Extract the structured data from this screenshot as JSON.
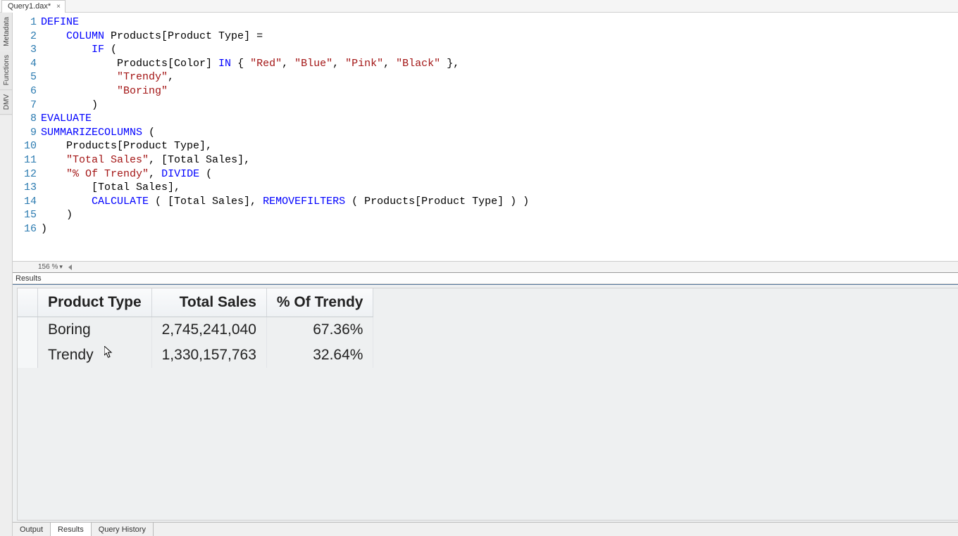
{
  "tab": {
    "title": "Query1.dax*",
    "close": "×"
  },
  "sideTabs": [
    "Metadata",
    "Functions",
    "DMV"
  ],
  "editor": {
    "zoom": "156 %",
    "lines": [
      {
        "n": 1,
        "tokens": [
          [
            "k-blue",
            "DEFINE"
          ]
        ]
      },
      {
        "n": 2,
        "tokens": [
          [
            "",
            "    "
          ],
          [
            "k-blue",
            "COLUMN"
          ],
          [
            "",
            " Products[Product Type] ="
          ]
        ]
      },
      {
        "n": 3,
        "tokens": [
          [
            "",
            "        "
          ],
          [
            "k-blue",
            "IF"
          ],
          [
            "",
            " ("
          ]
        ]
      },
      {
        "n": 4,
        "tokens": [
          [
            "",
            "            Products[Color] "
          ],
          [
            "k-blue",
            "IN"
          ],
          [
            "",
            " { "
          ],
          [
            "k-str",
            "\"Red\""
          ],
          [
            "",
            ", "
          ],
          [
            "k-str",
            "\"Blue\""
          ],
          [
            "",
            ", "
          ],
          [
            "k-str",
            "\"Pink\""
          ],
          [
            "",
            ", "
          ],
          [
            "k-str",
            "\"Black\""
          ],
          [
            "",
            " },"
          ]
        ]
      },
      {
        "n": 5,
        "tokens": [
          [
            "",
            "            "
          ],
          [
            "k-str",
            "\"Trendy\""
          ],
          [
            "",
            ","
          ]
        ]
      },
      {
        "n": 6,
        "tokens": [
          [
            "",
            "            "
          ],
          [
            "k-str",
            "\"Boring\""
          ]
        ]
      },
      {
        "n": 7,
        "tokens": [
          [
            "",
            "        )"
          ]
        ]
      },
      {
        "n": 8,
        "tokens": [
          [
            "k-blue",
            "EVALUATE"
          ]
        ]
      },
      {
        "n": 9,
        "tokens": [
          [
            "k-blue",
            "SUMMARIZECOLUMNS"
          ],
          [
            "",
            " ("
          ]
        ]
      },
      {
        "n": 10,
        "tokens": [
          [
            "",
            "    Products[Product Type],"
          ]
        ]
      },
      {
        "n": 11,
        "tokens": [
          [
            "",
            "    "
          ],
          [
            "k-str",
            "\"Total Sales\""
          ],
          [
            "",
            ", [Total Sales],"
          ]
        ]
      },
      {
        "n": 12,
        "tokens": [
          [
            "",
            "    "
          ],
          [
            "k-str",
            "\"% Of Trendy\""
          ],
          [
            "",
            ", "
          ],
          [
            "k-blue",
            "DIVIDE"
          ],
          [
            "",
            " ("
          ]
        ]
      },
      {
        "n": 13,
        "tokens": [
          [
            "",
            "        [Total Sales],"
          ]
        ]
      },
      {
        "n": 14,
        "tokens": [
          [
            "",
            "        "
          ],
          [
            "k-blue",
            "CALCULATE"
          ],
          [
            "",
            " ( [Total Sales], "
          ],
          [
            "k-blue",
            "REMOVEFILTERS"
          ],
          [
            "",
            " ( Products[Product Type] ) )"
          ]
        ]
      },
      {
        "n": 15,
        "tokens": [
          [
            "",
            "    )"
          ]
        ]
      },
      {
        "n": 16,
        "tokens": [
          [
            "",
            ")"
          ]
        ]
      }
    ]
  },
  "resultsLabel": "Results",
  "results": {
    "columns": [
      "Product Type",
      "Total Sales",
      "% Of Trendy"
    ],
    "rows": [
      {
        "product_type": "Boring",
        "total_sales": "2,745,241,040",
        "pct": "67.36%"
      },
      {
        "product_type": "Trendy",
        "total_sales": "1,330,157,763",
        "pct": "32.64%"
      }
    ]
  },
  "bottomTabs": {
    "items": [
      "Output",
      "Results",
      "Query History"
    ],
    "active": 1
  }
}
